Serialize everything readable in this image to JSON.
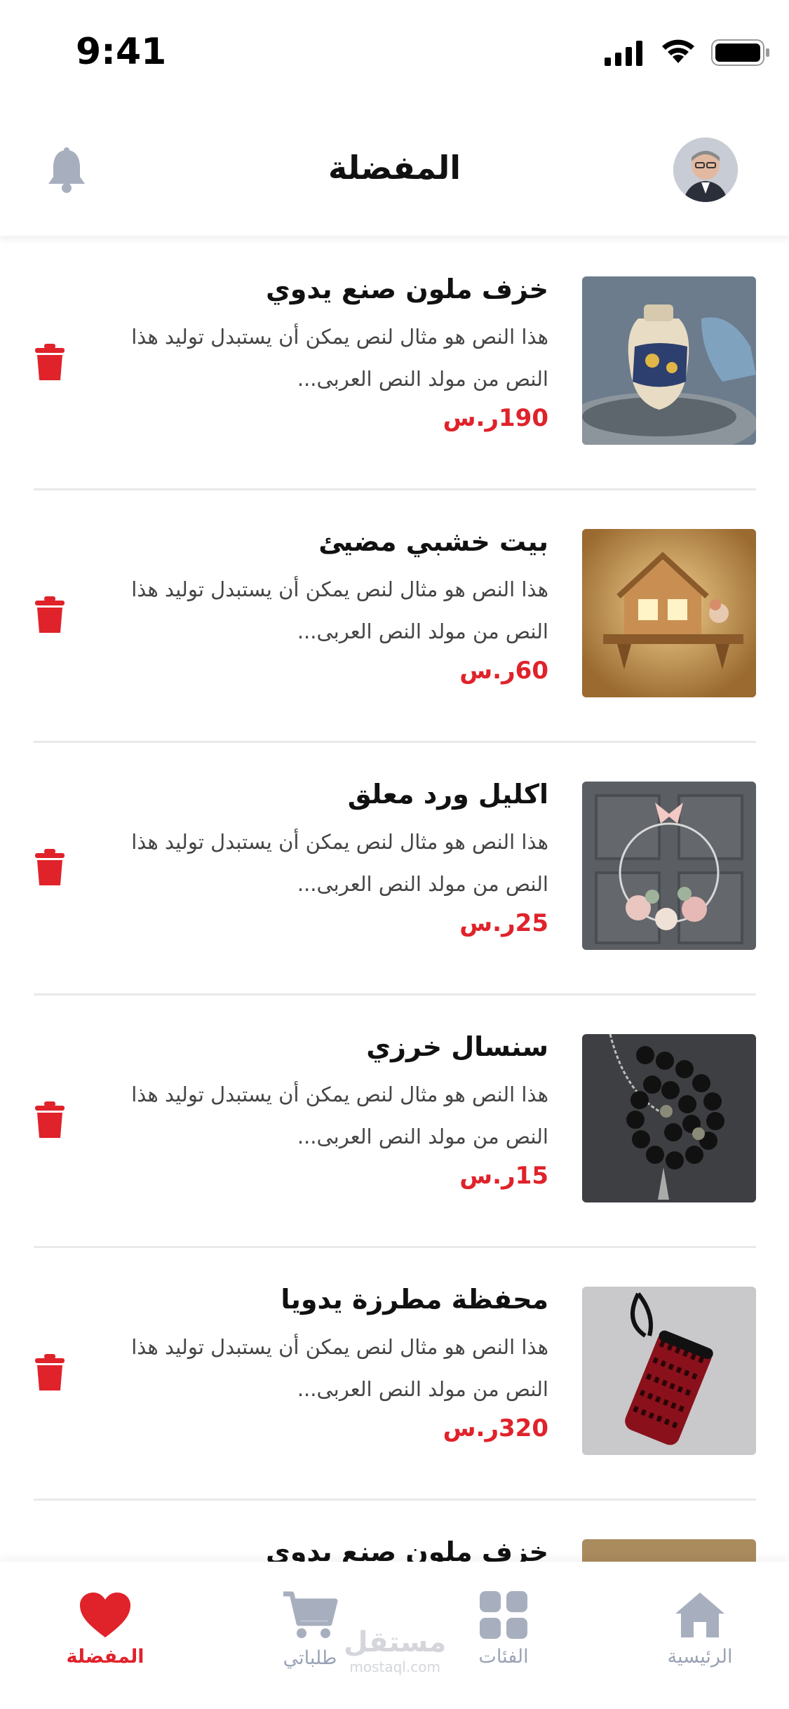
{
  "status_bar": {
    "time": "9:41"
  },
  "header": {
    "title": "المفضلة"
  },
  "items": [
    {
      "name": "خزف ملون صنع يدوي",
      "description": "هذا النص هو مثال لنص يمكن أن يستبدل توليد هذا النص من مولد النص العربى...",
      "price": "190ر.س"
    },
    {
      "name": "بيت خشبي مضيئ",
      "description": "هذا النص هو مثال لنص يمكن أن يستبدل توليد هذا النص من مولد النص العربى...",
      "price": "60ر.س"
    },
    {
      "name": "اكليل ورد معلق",
      "description": "هذا النص هو مثال لنص يمكن أن يستبدل توليد هذا النص من مولد النص العربى...",
      "price": "25ر.س"
    },
    {
      "name": "سنسال خرزي",
      "description": "هذا النص هو مثال لنص يمكن أن يستبدل توليد هذا النص من مولد النص العربى...",
      "price": "15ر.س"
    },
    {
      "name": "محفظة مطرزة يدويا",
      "description": "هذا النص هو مثال لنص يمكن أن يستبدل توليد هذا النص من مولد النص العربى...",
      "price": "320ر.س"
    },
    {
      "name": "خزف ملون صنع يدوي",
      "description": "",
      "price": ""
    }
  ],
  "tabbar": {
    "home": "الرئيسية",
    "categories": "الفئات",
    "orders": "طلباتي",
    "favorites": "المفضلة"
  },
  "watermark": {
    "brand": "مستقل",
    "url": "mostaql.com"
  },
  "colors": {
    "accent": "#e0222a",
    "inactive": "#9aa3b5"
  },
  "icons": [
    "bell-icon",
    "trash-icon",
    "home-icon",
    "grid-icon",
    "cart-icon",
    "heart-icon"
  ]
}
